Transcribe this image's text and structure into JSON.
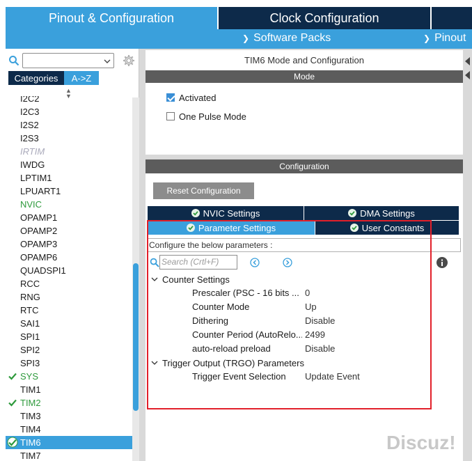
{
  "top_tabs": {
    "pinout": "Pinout & Configuration",
    "clock": "Clock Configuration"
  },
  "subbar": {
    "software_packs": "Software Packs",
    "pinout": "Pinout"
  },
  "left": {
    "tabs": [
      "Categories",
      "A->Z"
    ],
    "peripherals": [
      {
        "label": "I2C2",
        "style": "normal"
      },
      {
        "label": "I2C3",
        "style": "normal"
      },
      {
        "label": "I2S2",
        "style": "normal"
      },
      {
        "label": "I2S3",
        "style": "normal"
      },
      {
        "label": "IRTIM",
        "style": "disabled"
      },
      {
        "label": "IWDG",
        "style": "normal"
      },
      {
        "label": "LPTIM1",
        "style": "normal"
      },
      {
        "label": "LPUART1",
        "style": "normal"
      },
      {
        "label": "NVIC",
        "style": "green"
      },
      {
        "label": "OPAMP1",
        "style": "normal"
      },
      {
        "label": "OPAMP2",
        "style": "normal"
      },
      {
        "label": "OPAMP3",
        "style": "normal"
      },
      {
        "label": "OPAMP6",
        "style": "normal"
      },
      {
        "label": "QUADSPI1",
        "style": "normal"
      },
      {
        "label": "RCC",
        "style": "normal"
      },
      {
        "label": "RNG",
        "style": "normal"
      },
      {
        "label": "RTC",
        "style": "normal"
      },
      {
        "label": "SAI1",
        "style": "normal"
      },
      {
        "label": "SPI1",
        "style": "normal"
      },
      {
        "label": "SPI2",
        "style": "normal"
      },
      {
        "label": "SPI3",
        "style": "normal"
      },
      {
        "label": "SYS",
        "style": "green-check"
      },
      {
        "label": "TIM1",
        "style": "normal"
      },
      {
        "label": "TIM2",
        "style": "green-check"
      },
      {
        "label": "TIM3",
        "style": "normal"
      },
      {
        "label": "TIM4",
        "style": "normal"
      },
      {
        "label": "TIM6",
        "style": "selected-check"
      },
      {
        "label": "TIM7",
        "style": "normal"
      }
    ]
  },
  "mode": {
    "title": "TIM6 Mode and Configuration",
    "header": "Mode",
    "activated": "Activated",
    "activated_checked": true,
    "one_pulse": "One Pulse Mode",
    "one_pulse_checked": false
  },
  "config": {
    "header": "Configuration",
    "reset_button": "Reset Configuration",
    "tabs": {
      "nvic": "NVIC Settings",
      "dma": "DMA Settings",
      "params": "Parameter Settings",
      "user": "User Constants"
    },
    "configure_label": "Configure the below parameters :",
    "search_placeholder": "Search (Crtl+F)",
    "groups": {
      "counter": "Counter Settings",
      "trigger": "Trigger Output (TRGO) Parameters"
    },
    "counter_params": [
      {
        "name": "Prescaler (PSC - 16 bits ...",
        "value": "0"
      },
      {
        "name": "Counter Mode",
        "value": "Up"
      },
      {
        "name": "Dithering",
        "value": "Disable"
      },
      {
        "name": "Counter Period (AutoRelo...",
        "value": "2499"
      },
      {
        "name": "auto-reload preload",
        "value": "Disable"
      }
    ],
    "trigger_params": [
      {
        "name": "Trigger Event Selection",
        "value": "Update Event"
      }
    ]
  },
  "watermark": "Discuz!",
  "colors": {
    "accent_blue": "#3aa0dc",
    "navy": "#0d2a4a",
    "green": "#2e9a3c",
    "highlight_red": "#e2202a"
  }
}
